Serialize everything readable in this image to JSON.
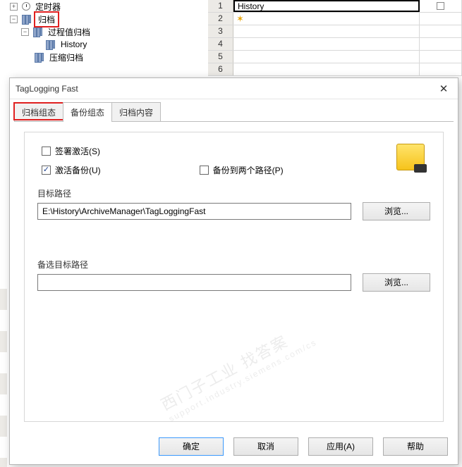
{
  "tree": {
    "timer_label": "定时器",
    "archive_label": "归档",
    "process_archive_label": "过程值归档",
    "history_label": "History",
    "compress_archive_label": "压缩归档"
  },
  "grid": {
    "row1_value": "History",
    "star": "✶"
  },
  "dialog": {
    "title": "TagLogging Fast",
    "tabs": {
      "archive_group": "归档组态",
      "backup_group": "备份组态",
      "archive_content": "归档内容"
    },
    "sign_activate_label": "签署激活(S)",
    "activate_backup_label": "激活备份(U)",
    "backup_both_paths_label": "备份到两个路径(P)",
    "target_path_label": "目标路径",
    "target_path_value": "E:\\History\\ArchiveManager\\TagLoggingFast",
    "alt_target_path_label": "备选目标路径",
    "alt_target_path_value": "",
    "browse_label": "浏览...",
    "buttons": {
      "ok": "确定",
      "cancel": "取消",
      "apply": "应用(A)",
      "help": "帮助"
    }
  },
  "watermark": {
    "cn": "西门子工业   找答案",
    "en": "support.industry.siemens.com/cs"
  }
}
